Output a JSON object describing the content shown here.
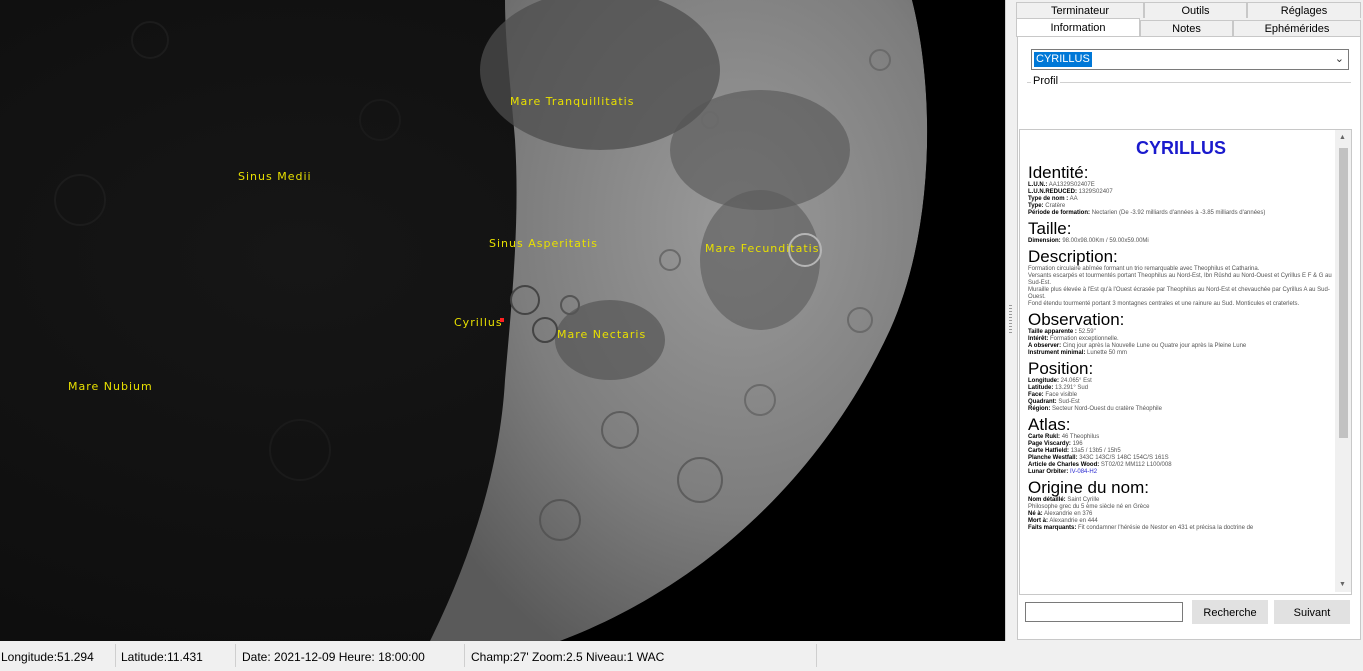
{
  "moon": {
    "labels": {
      "mare_tranquillitatis": "Mare Tranquillitatis",
      "sinus_medii": "Sinus Medii",
      "sinus_asperitatis": "Sinus Asperitatis",
      "mare_fecunditatis": "Mare Fecunditatis",
      "cyrillus": "Cyrillus",
      "mare_nectaris": "Mare Nectaris",
      "mare_nubium": "Mare Nubium"
    },
    "marker_color": "#ff2020",
    "label_color": "#e8e000"
  },
  "tabs": {
    "row1": [
      "Terminateur",
      "Outils",
      "Réglages"
    ],
    "row2": [
      "Information",
      "Notes",
      "Ephémérides"
    ],
    "active": "Information"
  },
  "selector": {
    "value": "CYRILLUS"
  },
  "profil_label": "Profil",
  "info": {
    "title": "CYRILLUS",
    "identite": {
      "heading": "Identité:",
      "lun_label": "L.U.N.:",
      "lun": "AA1329S02407E",
      "lunred_label": "L.U.N.REDUCED:",
      "lunred": "1329S02407",
      "typenom_label": "Type de nom :",
      "typenom": "AA",
      "type_label": "Type:",
      "type": "Cratère",
      "periode_label": "Période de formation:",
      "periode": "Nectarien (De -3.92 milliards d'années à -3.85 milliards d'années)"
    },
    "taille": {
      "heading": "Taille:",
      "dim_label": "Dimension:",
      "dim": "98.00x98.00Km / 59.00x59.00Mi"
    },
    "description": {
      "heading": "Description:",
      "text1": "Formation circulaire abîmée formant un trio remarquable avec Theophilus et Catharina.",
      "text2": "Versants escarpés et tourmentés portant Theophilus au Nord-Est, Ibn Rûshd au Nord-Ouest et Cyrillus E F & G au Sud-Est.",
      "text3": "Muraille plus élevée à l'Est qu'à l'Ouest écrasée par Theophilus au Nord-Est et chevauchée par Cyrillus A au Sud-Ouest.",
      "text4": "Fond étendu tourmenté portant 3 montagnes centrales et une rainure au Sud. Monticules et craterlets."
    },
    "observation": {
      "heading": "Observation:",
      "taille_label": "Taille apparente :",
      "taille": "52.59\"",
      "interet_label": "Intérêt:",
      "interet": "Formation exceptionnelle.",
      "observer_label": "A observer:",
      "observer": "Cinq jour après la Nouvelle Lune ou Quatre jour après la Pleine Lune",
      "instrument_label": "Instrument minimal:",
      "instrument": "Lunette 50 mm"
    },
    "position": {
      "heading": "Position:",
      "longitude_label": "Longitude:",
      "longitude": "24.065° Est",
      "latitude_label": "Latitude:",
      "latitude": "13.291° Sud",
      "face_label": "Face:",
      "face": "Face visible",
      "quadrant_label": "Quadrant:",
      "quadrant": "Sud-Est",
      "region_label": "Région:",
      "region": "Secteur Nord-Ouest du cratère Théophile"
    },
    "atlas": {
      "heading": "Atlas:",
      "rukl_label": "Carte Rukl:",
      "rukl": "46 Theophilus",
      "viscardy_label": "Page Viscardy:",
      "viscardy": "196",
      "hatfield_label": "Carte Hatfield:",
      "hatfield": "13a5 / 13b5 / 15h5",
      "westfall_label": "Planche Westfall:",
      "westfall": "343C 143C/S 148C 154C/S 161S",
      "wood_label": "Article de Charles Wood:",
      "wood": "ST02/02 MM112 L100/008",
      "orbiter_label": "Lunar Orbiter:",
      "orbiter": "IV-084-H2"
    },
    "origine": {
      "heading": "Origine du nom:",
      "nom_label": "Nom détaillé:",
      "nom": "Saint Cyrille",
      "desc": "Philosophe grec du 5 ème siècle né en Grèce",
      "ne_label": "Né à:",
      "ne": "Alexandrie en 376",
      "mort_label": "Mort à:",
      "mort": "Alexandrie en 444",
      "faits_label": "Faits marquants:",
      "faits": "Fit condamner l'hérésie de Nestor en 431 et précisa la doctrine de"
    }
  },
  "search": {
    "value": "",
    "button": "Recherche",
    "next": "Suivant"
  },
  "status": {
    "longitude": "Longitude:51.294",
    "latitude": "Latitude:11.431",
    "datetime": "Date: 2021-12-09   Heure: 18:00:00",
    "view": "Champ:27' Zoom:2.5  Niveau:1 WAC"
  }
}
